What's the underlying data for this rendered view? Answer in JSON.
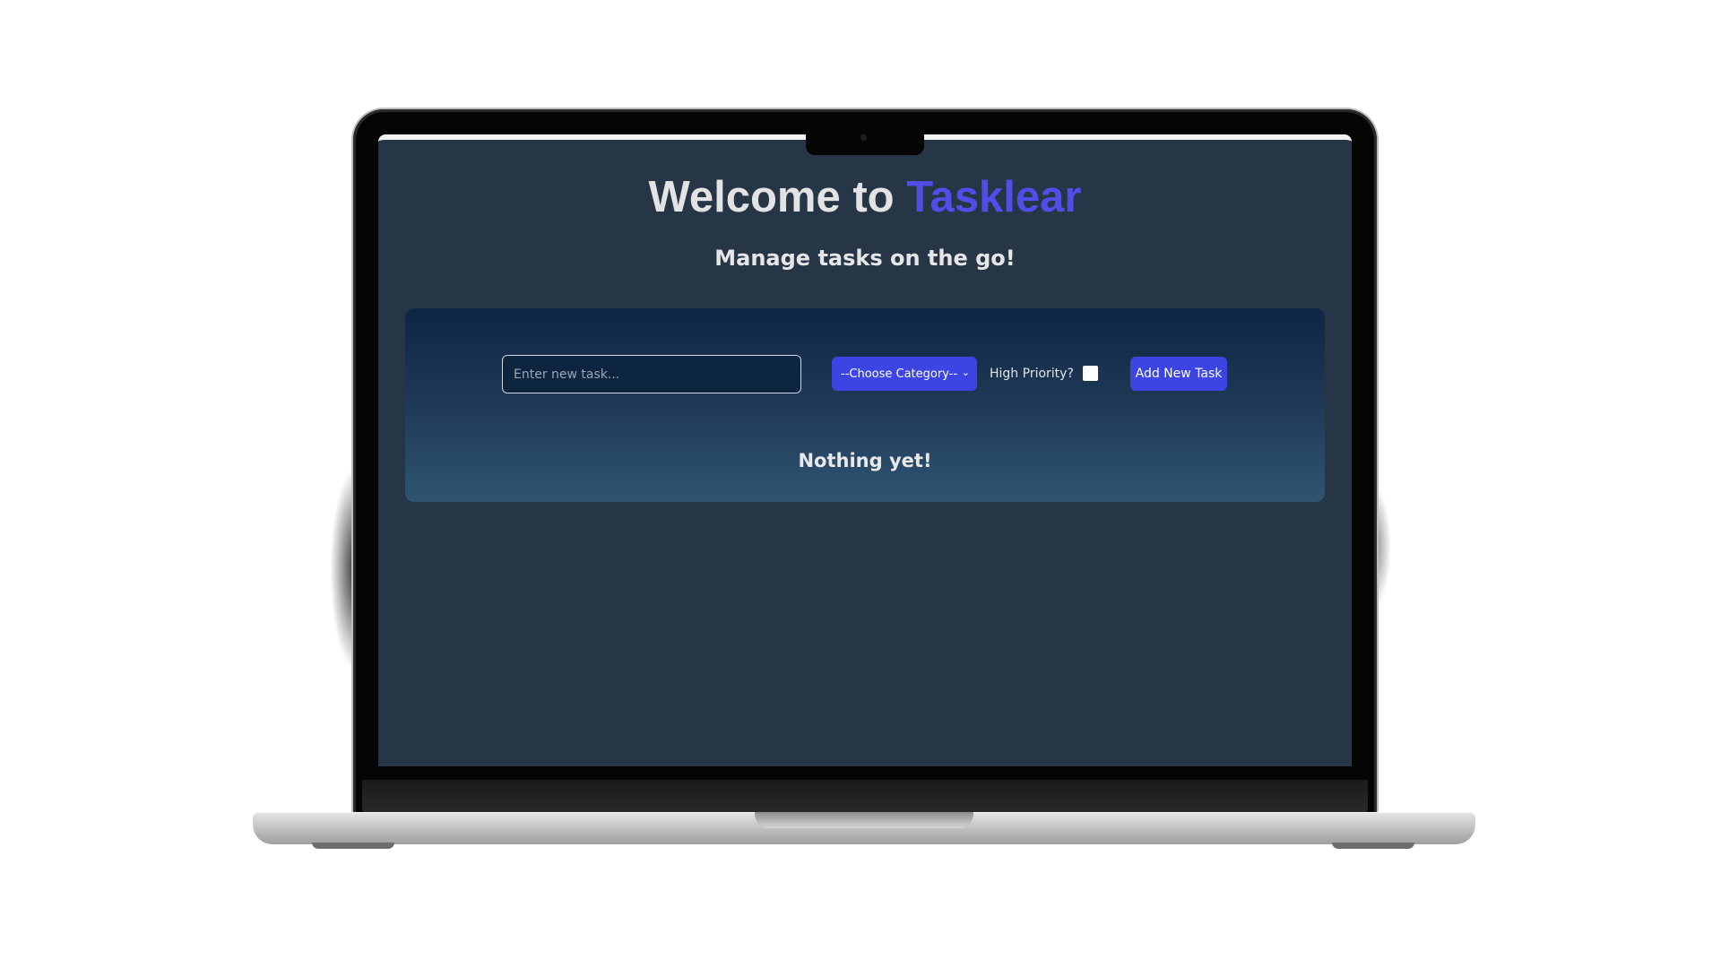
{
  "header": {
    "title_prefix": "Welcome to ",
    "brand_name": "Tasklear",
    "subtitle": "Manage tasks on the go!"
  },
  "form": {
    "task_input": {
      "placeholder": "Enter new task...",
      "value": ""
    },
    "category_select": {
      "selected": "--Choose Category--",
      "chevron": "chevron-down-icon"
    },
    "priority": {
      "label": "High Priority?",
      "checked": false
    },
    "add_button_label": "Add New Task"
  },
  "list": {
    "empty_message": "Nothing yet!"
  },
  "colors": {
    "accent": "#3c45e3",
    "brand": "#4f4ee9",
    "background": "#263646"
  }
}
